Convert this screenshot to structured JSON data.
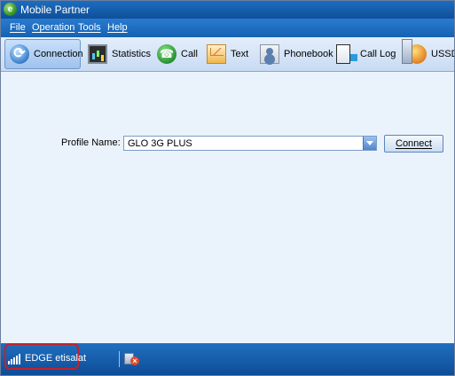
{
  "window": {
    "title": "Mobile Partner"
  },
  "menu": [
    {
      "label": "File"
    },
    {
      "label": "Operation"
    },
    {
      "label": "Tools"
    },
    {
      "label": "Help"
    }
  ],
  "toolbar": [
    {
      "label": "Connection",
      "icon": "connection-icon",
      "active": true
    },
    {
      "label": "Statistics",
      "icon": "statistics-icon"
    },
    {
      "label": "Call",
      "icon": "call-icon"
    },
    {
      "label": "Text",
      "icon": "text-message-icon"
    },
    {
      "label": "Phonebook",
      "icon": "phonebook-icon"
    },
    {
      "label": "Call Log",
      "icon": "call-log-icon"
    },
    {
      "label": "USSD",
      "icon": "ussd-icon"
    }
  ],
  "profile": {
    "label": "Profile Name:",
    "selected": "GLO 3G PLUS",
    "connect_label": "Connect"
  },
  "status": {
    "network_type": "EDGE",
    "operator": "etisalat"
  },
  "colors": {
    "title_bar": "#1562b3",
    "status_bar": "#0e4d96",
    "highlight": "#c8202a"
  }
}
